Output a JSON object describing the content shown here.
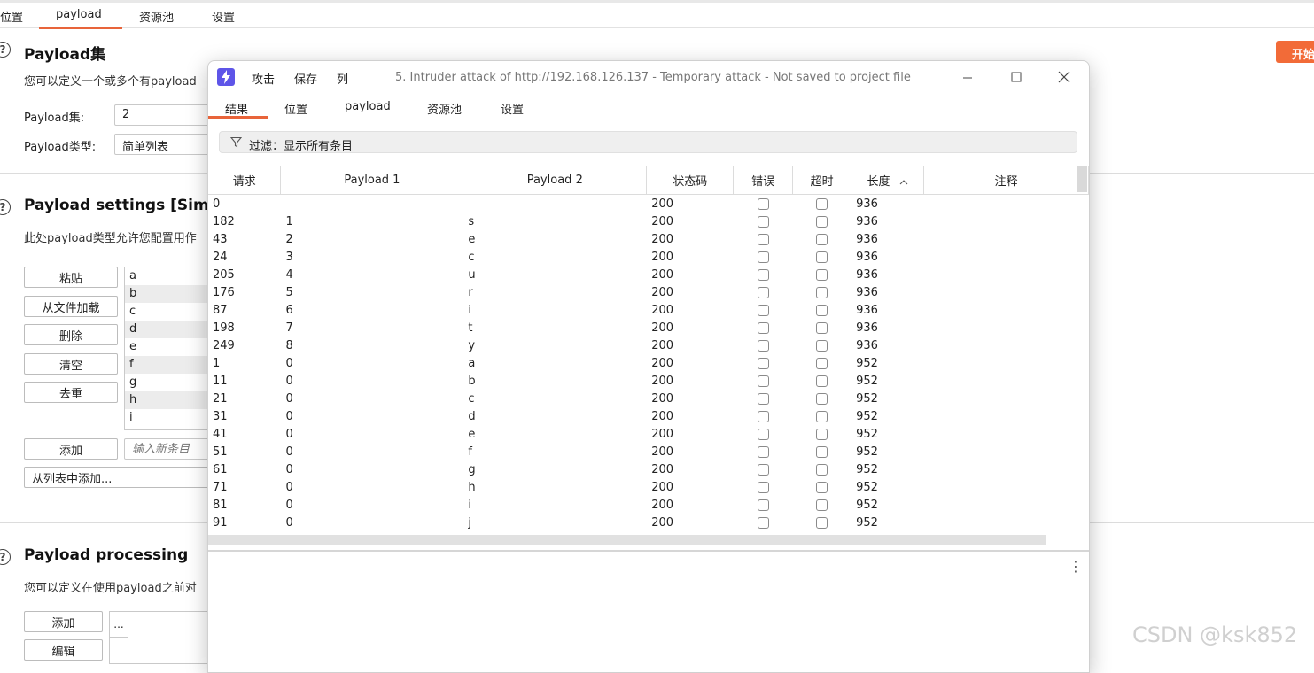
{
  "background": {
    "tabs": [
      "位置",
      "payload",
      "资源池",
      "设置"
    ],
    "start_button": "开始",
    "sections": {
      "payload_sets": {
        "title": "Payload集",
        "description": "您可以定义一个或多个有payload",
        "set_label": "Payload集:",
        "set_value": "2",
        "type_label": "Payload类型:",
        "type_value": "简单列表"
      },
      "payload_settings": {
        "title": "Payload settings [Simple",
        "description": "此处payload类型允许您配置用作",
        "buttons": [
          "粘贴",
          "从文件加载",
          "删除",
          "清空",
          "去重"
        ],
        "list_items": [
          "a",
          "b",
          "c",
          "d",
          "e",
          "f",
          "g",
          "h",
          "i"
        ],
        "add_button": "添加",
        "add_placeholder": "输入新条目",
        "add_from_list": "从列表中添加..."
      },
      "payload_processing": {
        "title": "Payload processing",
        "description": "您可以定义在使用payload之前对",
        "add_button": "添加",
        "edit_button": "编辑",
        "first_cell": "..."
      }
    }
  },
  "attack_window": {
    "menu": [
      "攻击",
      "保存",
      "列"
    ],
    "title": "5. Intruder attack of http://192.168.126.137 - Temporary attack - Not saved to project file",
    "tabs": [
      "结果",
      "位置",
      "payload",
      "资源池",
      "设置"
    ],
    "filter_text": "过滤：显示所有条目",
    "columns": [
      "请求",
      "Payload 1",
      "Payload 2",
      "状态码",
      "错误",
      "超时",
      "长度",
      "注释"
    ],
    "sort_indicator": "^",
    "rows": [
      {
        "req": "0",
        "p1": "",
        "p2": "",
        "status": "200",
        "len": "936"
      },
      {
        "req": "182",
        "p1": "1",
        "p2": "s",
        "status": "200",
        "len": "936"
      },
      {
        "req": "43",
        "p1": "2",
        "p2": "e",
        "status": "200",
        "len": "936"
      },
      {
        "req": "24",
        "p1": "3",
        "p2": "c",
        "status": "200",
        "len": "936"
      },
      {
        "req": "205",
        "p1": "4",
        "p2": "u",
        "status": "200",
        "len": "936"
      },
      {
        "req": "176",
        "p1": "5",
        "p2": "r",
        "status": "200",
        "len": "936"
      },
      {
        "req": "87",
        "p1": "6",
        "p2": "i",
        "status": "200",
        "len": "936"
      },
      {
        "req": "198",
        "p1": "7",
        "p2": "t",
        "status": "200",
        "len": "936"
      },
      {
        "req": "249",
        "p1": "8",
        "p2": "y",
        "status": "200",
        "len": "936"
      },
      {
        "req": "1",
        "p1": "0",
        "p2": "a",
        "status": "200",
        "len": "952"
      },
      {
        "req": "11",
        "p1": "0",
        "p2": "b",
        "status": "200",
        "len": "952"
      },
      {
        "req": "21",
        "p1": "0",
        "p2": "c",
        "status": "200",
        "len": "952"
      },
      {
        "req": "31",
        "p1": "0",
        "p2": "d",
        "status": "200",
        "len": "952"
      },
      {
        "req": "41",
        "p1": "0",
        "p2": "e",
        "status": "200",
        "len": "952"
      },
      {
        "req": "51",
        "p1": "0",
        "p2": "f",
        "status": "200",
        "len": "952"
      },
      {
        "req": "61",
        "p1": "0",
        "p2": "g",
        "status": "200",
        "len": "952"
      },
      {
        "req": "71",
        "p1": "0",
        "p2": "h",
        "status": "200",
        "len": "952"
      },
      {
        "req": "81",
        "p1": "0",
        "p2": "i",
        "status": "200",
        "len": "952"
      },
      {
        "req": "91",
        "p1": "0",
        "p2": "j",
        "status": "200",
        "len": "952"
      }
    ]
  },
  "watermark": "CSDN @ksk852",
  "colors": {
    "accent": "#e8643a",
    "start_button": "#f26b38",
    "app_icon": "#5e55e8"
  }
}
